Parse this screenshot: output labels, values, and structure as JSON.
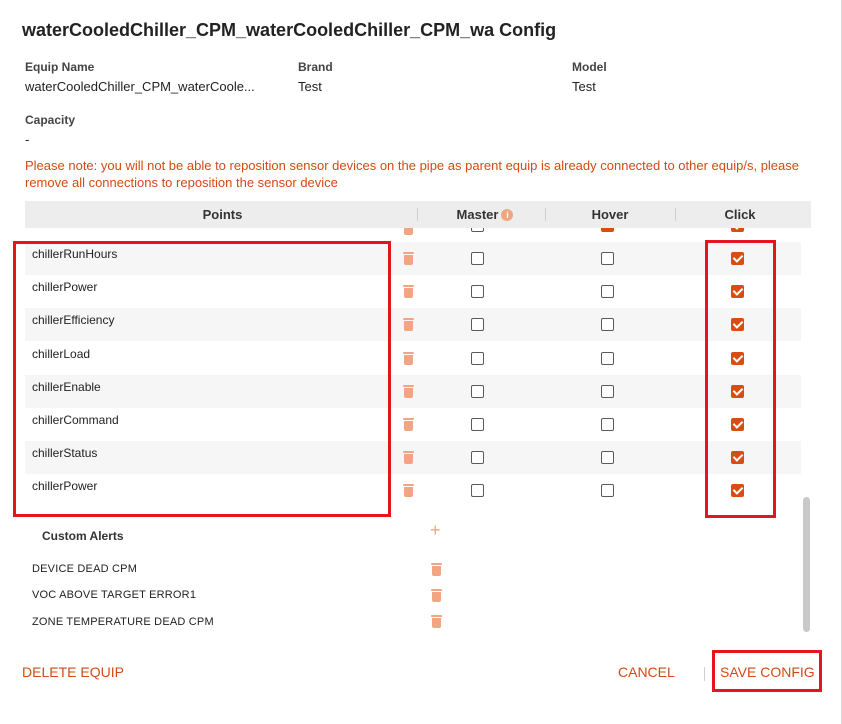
{
  "dialog": {
    "title": "waterCooledChiller_CPM_waterCooledChiller_CPM_wa Config"
  },
  "equip": {
    "name_label": "Equip Name",
    "name_value": "waterCooledChiller_CPM_waterCoole...",
    "brand_label": "Brand",
    "brand_value": "Test",
    "model_label": "Model",
    "model_value": "Test",
    "capacity_label": "Capacity",
    "capacity_value": "-"
  },
  "note": "Please note: you will not be able to reposition sensor devices on the pipe as parent equip is already connected to other equip/s, please remove all connections to reposition the sensor device",
  "table": {
    "columns": {
      "points": "Points",
      "master": "Master",
      "hover": "Hover",
      "click": "Click"
    },
    "rows": [
      {
        "point": "chillerRunHours",
        "master": false,
        "hover": false,
        "click": true
      },
      {
        "point": "chillerPower",
        "master": false,
        "hover": false,
        "click": true
      },
      {
        "point": "chillerEfficiency",
        "master": false,
        "hover": false,
        "click": true
      },
      {
        "point": "chillerLoad",
        "master": false,
        "hover": false,
        "click": true
      },
      {
        "point": "chillerEnable",
        "master": false,
        "hover": false,
        "click": true
      },
      {
        "point": "chillerCommand",
        "master": false,
        "hover": false,
        "click": true
      },
      {
        "point": "chillerStatus",
        "master": false,
        "hover": false,
        "click": true
      },
      {
        "point": "chillerPower",
        "master": false,
        "hover": false,
        "click": true
      }
    ]
  },
  "custom_alerts": {
    "title": "Custom Alerts",
    "items": [
      "DEVICE DEAD CPM",
      "VOC ABOVE TARGET ERROR1",
      "ZONE TEMPERATURE DEAD CPM"
    ]
  },
  "footer": {
    "delete_label": "DELETE EQUIP",
    "cancel_label": "CANCEL",
    "save_label": "SAVE CONFIG"
  },
  "colors": {
    "accent": "#d94d12",
    "note": "#d24a14",
    "highlight": "#e3151f"
  },
  "icons": {
    "delete_row": "trash-icon",
    "add_alert": "plus-icon",
    "master_info": "info-icon"
  }
}
